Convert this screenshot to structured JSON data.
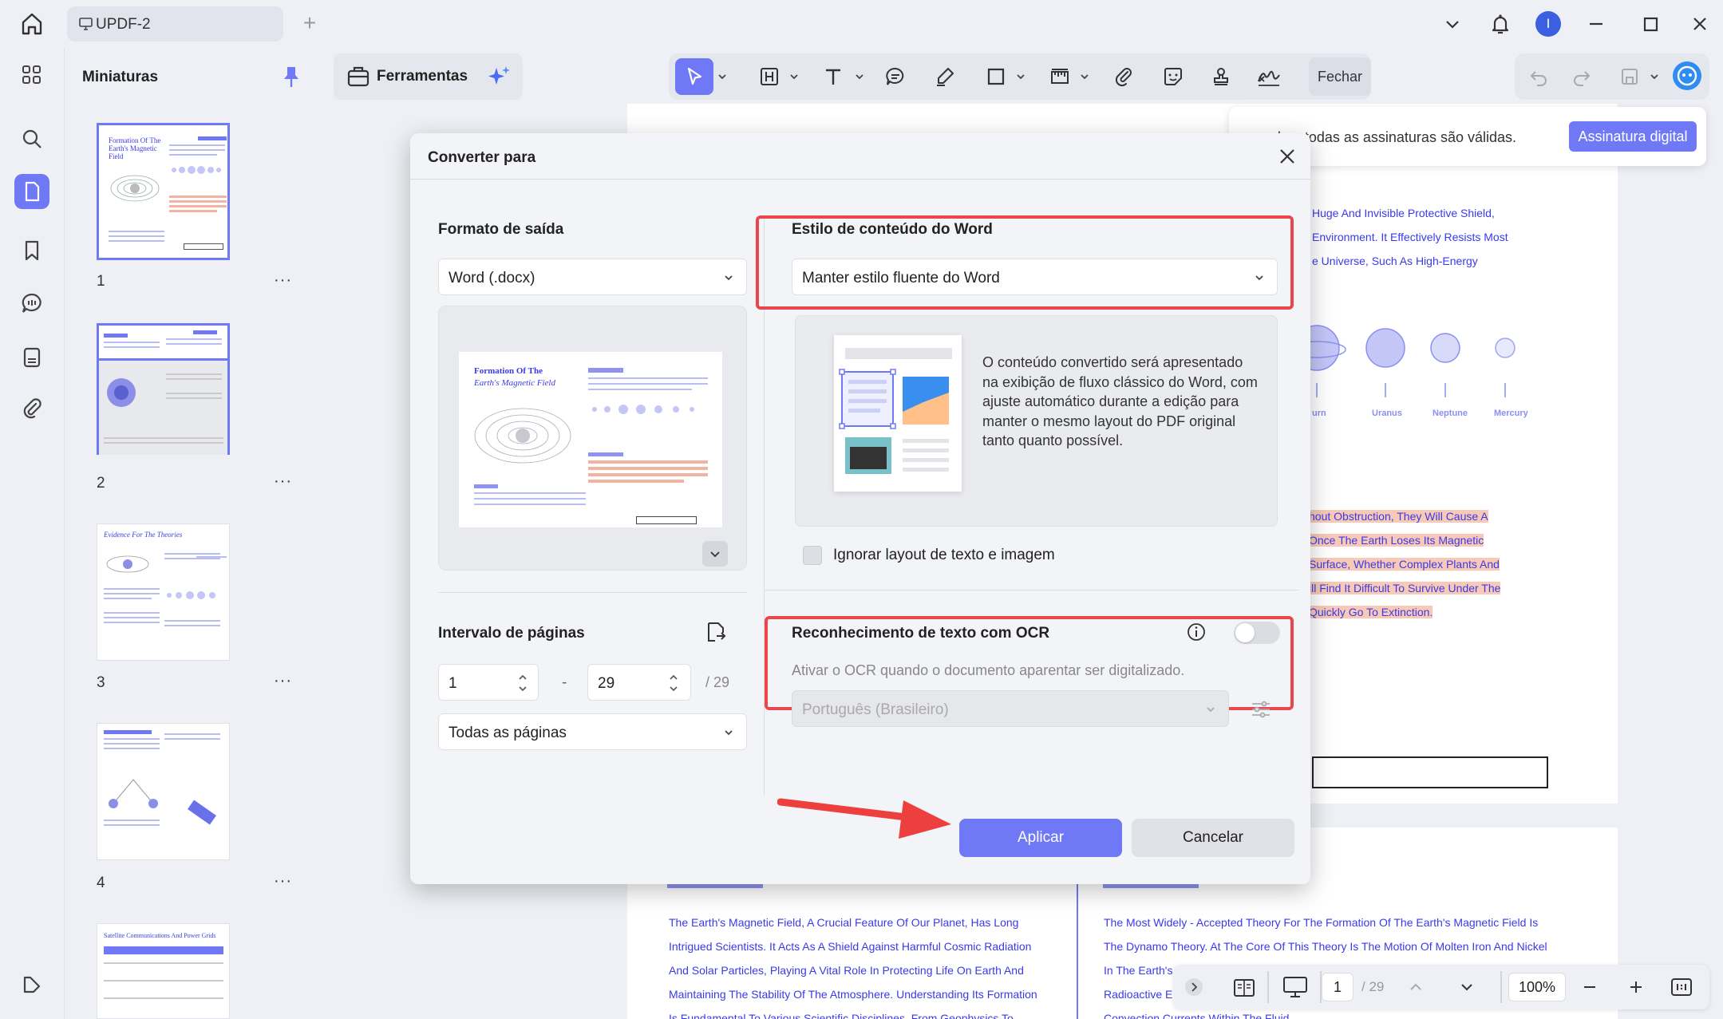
{
  "titlebar": {
    "tab_title": "UPDF-2",
    "avatar_letter": "I"
  },
  "thumbnails": {
    "panel_title": "Miniaturas",
    "pages": [
      {
        "number": "1",
        "heading": "Formation Of The Earth's Magnetic Field"
      },
      {
        "number": "2",
        "heading": ""
      },
      {
        "number": "3",
        "heading": "Evidence For The Theories"
      },
      {
        "number": "4",
        "heading": ""
      },
      {
        "number": "",
        "heading": "Satellite Communications And Power Grids"
      }
    ],
    "more": "···"
  },
  "toolbar": {
    "tools_label": "Ferramentas",
    "close_label": "Fechar"
  },
  "signature_bar": {
    "text": "do e todas as assinaturas são válidas.",
    "button": "Assinatura digital"
  },
  "document": {
    "top_lines": [
      "Huge And Invisible Protective Shield,",
      "Environment. It Effectively Resists Most",
      "e Universe, Such As High-Energy"
    ],
    "planets": [
      "urn",
      "Uranus",
      "Neptune",
      "Mercury"
    ],
    "highlight_lines": [
      "hout Obstruction, They Will Cause A",
      "Once The Earth Loses Its Magnetic",
      "Surface, Whether Complex Plants And",
      "ill Find It Difficult To Survive Under The",
      "Quickly Go To Extinction."
    ],
    "left_lines": [
      "The Earth's Magnetic Field, A Crucial Feature Of Our Planet, Has Long",
      "Intrigued Scientists. It Acts As A Shield Against Harmful Cosmic Radiation",
      "And Solar Particles, Playing A Vital Role In Protecting Life On Earth And",
      "Maintaining The Stability Of The Atmosphere. Understanding Its Formation",
      "Is Fundamental To Various Scientific Disciplines, From Geophysics To"
    ],
    "right_lines": [
      "The Most Widely - Accepted Theory For The Formation Of The Earth's Magnetic Field Is",
      "The Dynamo Theory. At The Core Of This Theory Is The Motion Of Molten Iron And Nickel",
      "In The Earth's O",
      "Radioactive El",
      "Convection Currents Within The Fluid"
    ]
  },
  "bottom_nav": {
    "current_page": "1",
    "total_pages": "/ 29",
    "zoom": "100%"
  },
  "dialog": {
    "title": "Converter para",
    "output_format_label": "Formato de saída",
    "output_format_value": "Word (.docx)",
    "preview": {
      "title_line1": "Formation Of The",
      "title_line2": "Earth's Magnetic Field"
    },
    "page_range_label": "Intervalo de páginas",
    "range_from": "1",
    "range_dash": "-",
    "range_to": "29",
    "range_total": "/ 29",
    "pages_option": "Todas as páginas",
    "word_style_label": "Estilo de conteúdo do Word",
    "word_style_value": "Manter estilo fluente do Word",
    "word_style_description": "O conteúdo convertido será apresentado na exibição de fluxo clássico do Word, com ajuste automático durante a edição para manter o mesmo layout do PDF original tanto quanto possível.",
    "ignore_layout_label": "Ignorar layout de texto e imagem",
    "ocr_label": "Reconhecimento de texto com OCR",
    "ocr_hint": "Ativar o OCR quando o documento aparentar ser digitalizado.",
    "ocr_language": "Português (Brasileiro)",
    "apply_button": "Aplicar",
    "cancel_button": "Cancelar"
  },
  "colors": {
    "accent": "#7079f5",
    "highlight_box": "#e8484d",
    "arrow": "#ee3f3f"
  }
}
